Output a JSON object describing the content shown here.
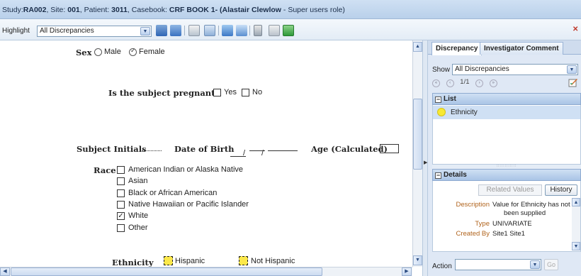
{
  "titlebar": {
    "study_label": "Study:",
    "study": "RA002",
    "site_label": ", Site: ",
    "site": "001",
    "patient_label": ", Patient: ",
    "patient": "3011",
    "casebook_label": ", Casebook: ",
    "casebook": "CRF BOOK 1-",
    "user": "(Alastair Clewlow",
    "role": " - Super users role)"
  },
  "toolbar": {
    "highlight_label": "Highlight",
    "highlight_value": "All Discrepancies"
  },
  "form": {
    "sex_label": "Sex",
    "sex_options": [
      "Male",
      "Female"
    ],
    "sex_selected": "Female",
    "pregnant_label": "Is the subject pregnant?",
    "pregnant_options": [
      "Yes",
      "No"
    ],
    "initials_label": "Subject Initials",
    "dob_label": "Date of Birth",
    "dob_sep": "/",
    "age_label": "Age (Calculated)",
    "race_label": "Race",
    "race_options": [
      {
        "label": "American Indian or Alaska Native",
        "checked": false
      },
      {
        "label": "Asian",
        "checked": false
      },
      {
        "label": "Black or African American",
        "checked": false
      },
      {
        "label": "Native Hawaiian or Pacific Islander",
        "checked": false
      },
      {
        "label": "White",
        "checked": true
      },
      {
        "label": "Other",
        "checked": false
      }
    ],
    "ethnicity_label": "Ethnicity",
    "ethnicity_options": [
      "Hispanic",
      "Not Hispanic"
    ]
  },
  "panel": {
    "tabs": [
      "Discrepancy",
      "Investigator Comment"
    ],
    "active_tab": "Discrepancy",
    "show_label": "Show",
    "show_value": "All Discrepancies",
    "pager_text": "1/1",
    "list_header": "List",
    "list_items": [
      "Ethnicity"
    ],
    "details_header": "Details",
    "related_values_btn": "Related Values",
    "history_btn": "History",
    "details": {
      "description_key": "Description",
      "description_line1": "Value for Ethnicity has not",
      "description_line2": "been supplied",
      "type_key": "Type",
      "type_value": "UNIVARIATE",
      "created_key": "Created By",
      "created_value": "Site1 Site1"
    },
    "action_label": "Action",
    "action_value": "",
    "go_btn": "Go"
  },
  "colors": {
    "titlebar_bg": "#c3d7ef",
    "discrepancy_marker": "#fce84a",
    "list_selection": "#cfe0f4",
    "detail_key": "#b0631c"
  }
}
